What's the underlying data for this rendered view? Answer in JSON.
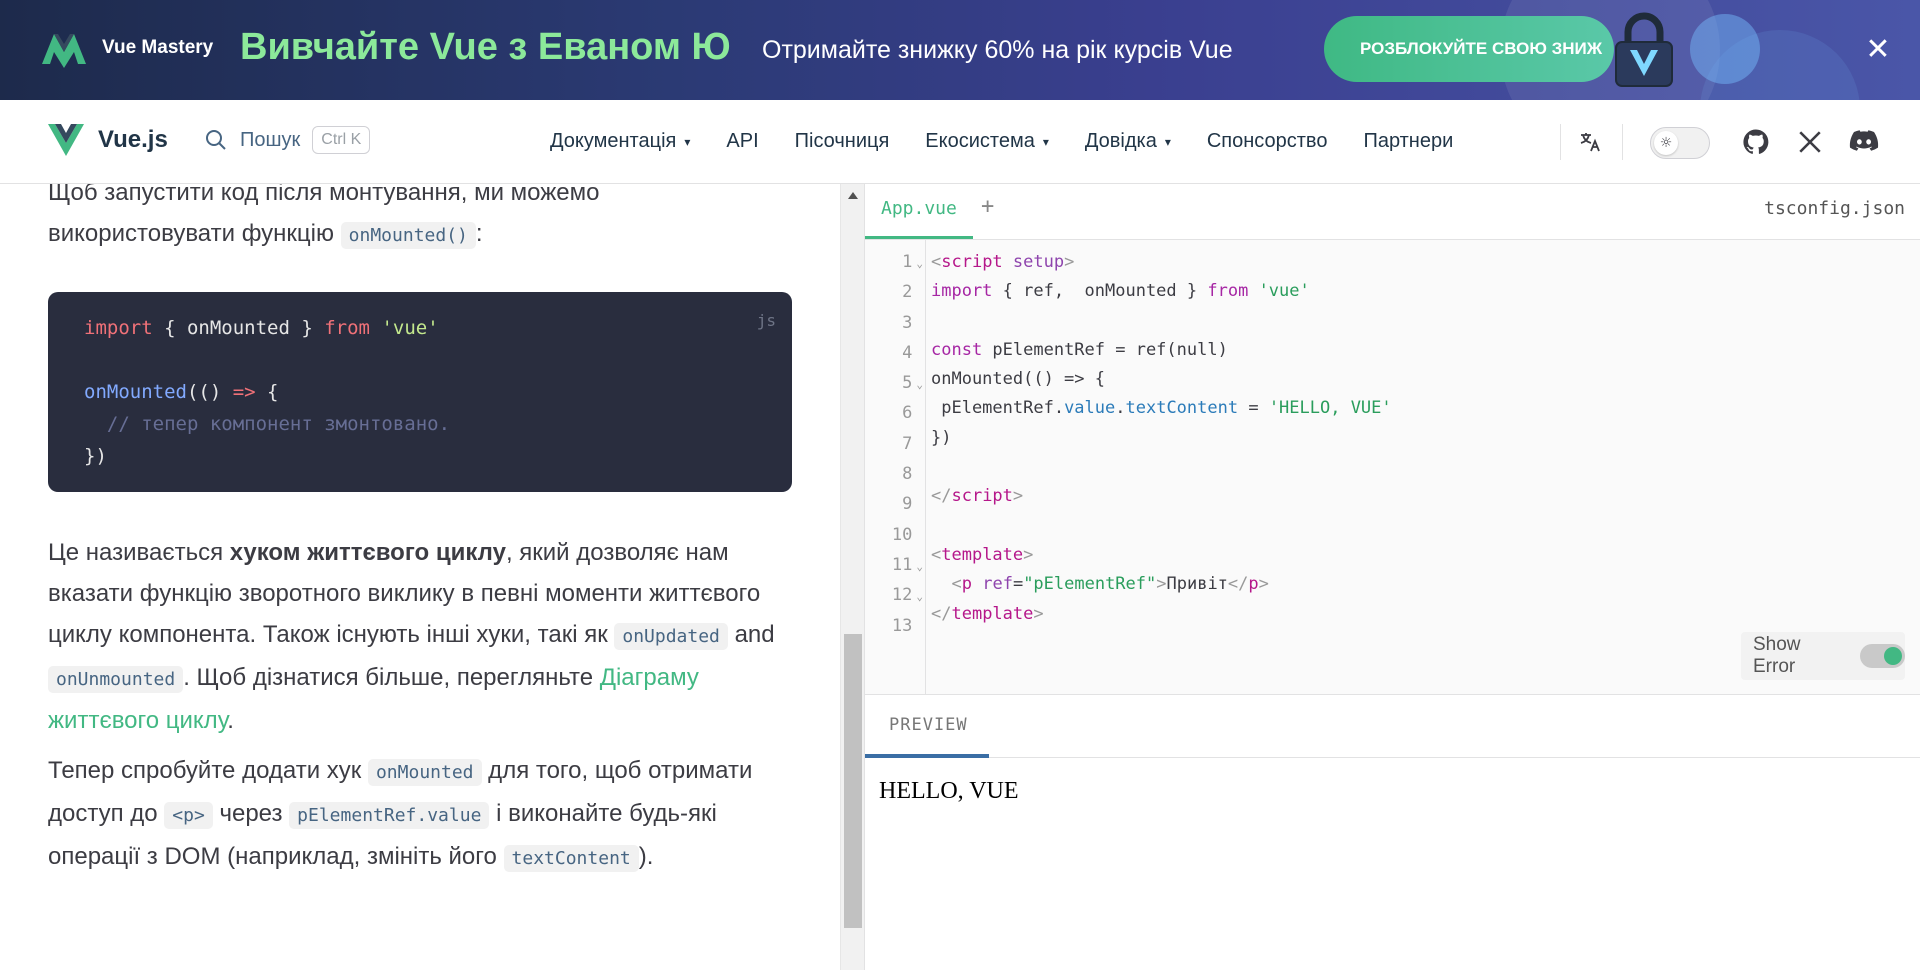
{
  "banner": {
    "brand": "Vue Mastery",
    "headline": "Вивчайте Vue з Еваном Ю",
    "offer": "Отримайте знижку 60% на рік курсів Vue",
    "cta": "РОЗБЛОКУЙТЕ СВОЮ ЗНИЖ",
    "close_icon": "close-icon"
  },
  "nav": {
    "brand": "Vue.js",
    "search_label": "Пошук",
    "search_shortcut": "Ctrl K",
    "links": [
      "Документація",
      "API",
      "Пісочниця",
      "Екосистема",
      "Довідка",
      "Спонсорство",
      "Партнери"
    ],
    "icons": [
      "translate-icon",
      "theme-toggle",
      "github-icon",
      "x-icon",
      "discord-icon"
    ]
  },
  "doc": {
    "intro_line1": "Щоб запустити код після монтування, ми можемо",
    "intro_line2_prefix": "використовувати функцію ",
    "intro_code": "onMounted()",
    "intro_line2_suffix": ":",
    "code_lang": "js",
    "code_lines": {
      "l1_kw": "import",
      "l1_mid": " { onMounted } ",
      "l1_from": "from",
      "l1_str": "'vue'",
      "l2_fn": "onMounted",
      "l2_mid": "(() ",
      "l2_arrow": "=>",
      "l2_end": " {",
      "l3_comment": "  // тепер компонент змонтовано.",
      "l4": "})"
    },
    "p2_a": "Це називається ",
    "p2_bold": "хуком життєвого циклу",
    "p2_b": ", який дозволяє нам вказати функцію зворотного виклику в певні моменти життєвого циклу компонента. Також існують інші хуки, такі як ",
    "p2_code1": "onUpdated",
    "p2_and": " and ",
    "p2_code2": "onUnmounted",
    "p2_c": ". Щоб дізнатися більше, перегляньте ",
    "p2_link": "Діаграму життєвого циклу",
    "p2_end": ".",
    "p3_a": "Тепер спробуйте додати хук ",
    "p3_code1": "onMounted",
    "p3_b": " для того, щоб отримати доступ до ",
    "p3_code2": "<p>",
    "p3_c": " через ",
    "p3_code3": "pElementRef.value",
    "p3_d": " і виконайте будь-які операції з DOM (наприклад, змініть його ",
    "p3_code4": "textContent",
    "p3_end": ")."
  },
  "repl": {
    "active_tab": "App.vue",
    "add_tab": "+",
    "right_tab": "tsconfig.json",
    "line_numbers": [
      "1",
      "2",
      "3",
      "4",
      "5",
      "6",
      "7",
      "8",
      "9",
      "10",
      "11",
      "12",
      "13"
    ],
    "folds": [
      "1",
      "5",
      "11",
      "12"
    ],
    "code": {
      "l1_open": "<",
      "l1_tag": "script",
      "l1_attr": " setup",
      "l1_close": ">",
      "l2_kw": "import",
      "l2_mid": " { ref,  onMounted } ",
      "l2_from": "from",
      "l2_str": "'vue'",
      "l4_kw": "const",
      "l4_rest": " pElementRef = ref(null)",
      "l5": "onMounted(() => {",
      "l6_a": " pElementRef.",
      "l6_prop1": "value",
      "l6_dot": ".",
      "l6_prop2": "textContent",
      "l6_eq": " = ",
      "l6_str": "'HELLO, VUE'",
      "l7": "})",
      "l9_open": "</",
      "l9_tag": "script",
      "l9_close": ">",
      "l11_open": "<",
      "l11_tag": "template",
      "l11_close": ">",
      "l12_indent": "  ",
      "l12_open": "<",
      "l12_tag": "p",
      "l12_attr": " ref",
      "l12_eq": "=",
      "l12_val": "\"pElementRef\"",
      "l12_gt": ">",
      "l12_text": "Привіт",
      "l12_end_open": "</",
      "l12_end_tag": "p",
      "l12_end_close": ">",
      "l13_open": "</",
      "l13_tag": "template",
      "l13_close": ">"
    },
    "show_error_label": "Show Error",
    "show_error_on": true,
    "preview_label": "PREVIEW",
    "preview_output": "HELLO, VUE"
  },
  "colors": {
    "accent": "#42b883",
    "banner_headline": "#8ce99a",
    "code_bg": "#292d3e"
  }
}
